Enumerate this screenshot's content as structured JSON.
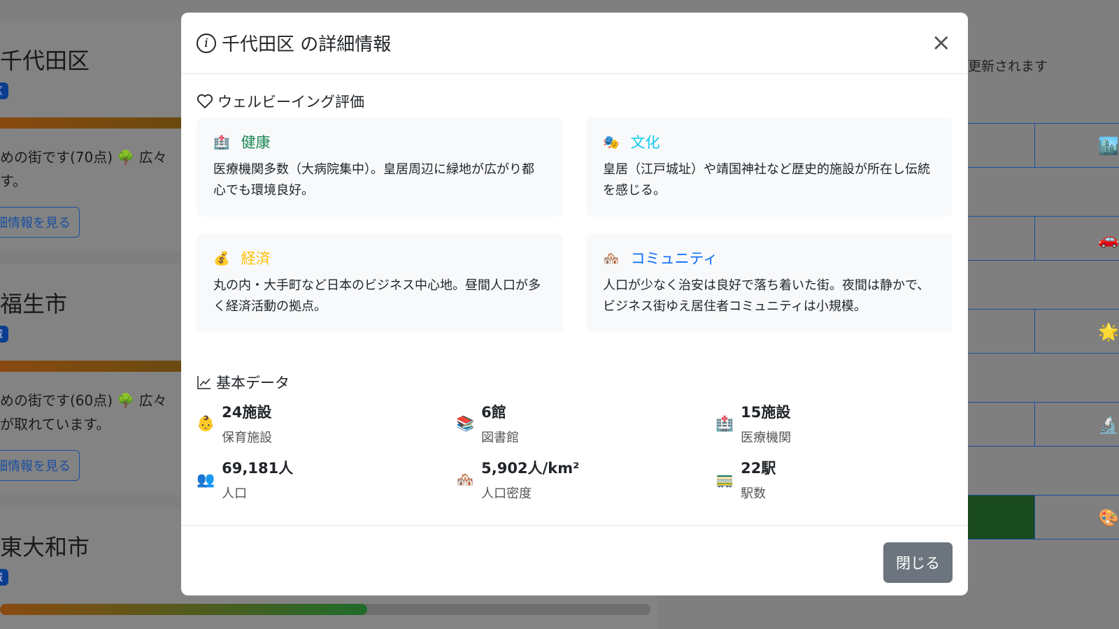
{
  "background": {
    "cards": [
      {
        "name": "千代田区",
        "badge": "区",
        "desc1": "めの街です(70点) 🌳 広々",
        "desc2": "す。",
        "button": "細情報を見る"
      },
      {
        "name": "福生市",
        "badge": "域",
        "desc1": "めの街です(60点) 🌳 広々",
        "desc2": "が取れています。",
        "button": "細情報を見る"
      },
      {
        "name": "東大和市",
        "badge": "域"
      }
    ],
    "right_note": "更新されます",
    "grid_icons": [
      "🏙️",
      "🚗",
      "🌟",
      "🔬",
      "🎨"
    ]
  },
  "modal": {
    "title": "千代田区 の詳細情報",
    "close_icon": "×",
    "wellbeing_title": "ウェルビーイング評価",
    "wellbeing": [
      {
        "icon": "🏥",
        "label": "健康",
        "color": "#198754",
        "text": "医療機関多数（大病院集中）。皇居周辺に緑地が広がり都心でも環境良好。"
      },
      {
        "icon": "🎭",
        "label": "文化",
        "color": "#0dcaf0",
        "text": "皇居（江戸城址）や靖国神社など歴史的施設が所在し伝統を感じる。"
      },
      {
        "icon": "💰",
        "label": "経済",
        "color": "#ffc107",
        "text": "丸の内・大手町など日本のビジネス中心地。昼間人口が多く経済活動の拠点。"
      },
      {
        "icon": "🏘️",
        "label": "コミュニティ",
        "color": "#0d6efd",
        "text": "人口が少なく治安は良好で落ち着いた街。夜間は静かで、ビジネス街ゆえ居住者コミュニティは小規模。"
      }
    ],
    "basic_title": "基本データ",
    "stats": [
      {
        "icon": "👶",
        "value": "24施設",
        "label": "保育施設"
      },
      {
        "icon": "📚",
        "value": "6館",
        "label": "図書館"
      },
      {
        "icon": "🏥",
        "value": "15施設",
        "label": "医療機関"
      },
      {
        "icon": "👥",
        "value": "69,181人",
        "label": "人口"
      },
      {
        "icon": "🏘️",
        "value": "5,902人/km²",
        "label": "人口密度"
      },
      {
        "icon": "🚃",
        "value": "22駅",
        "label": "駅数"
      }
    ],
    "close_button": "閉じる"
  }
}
